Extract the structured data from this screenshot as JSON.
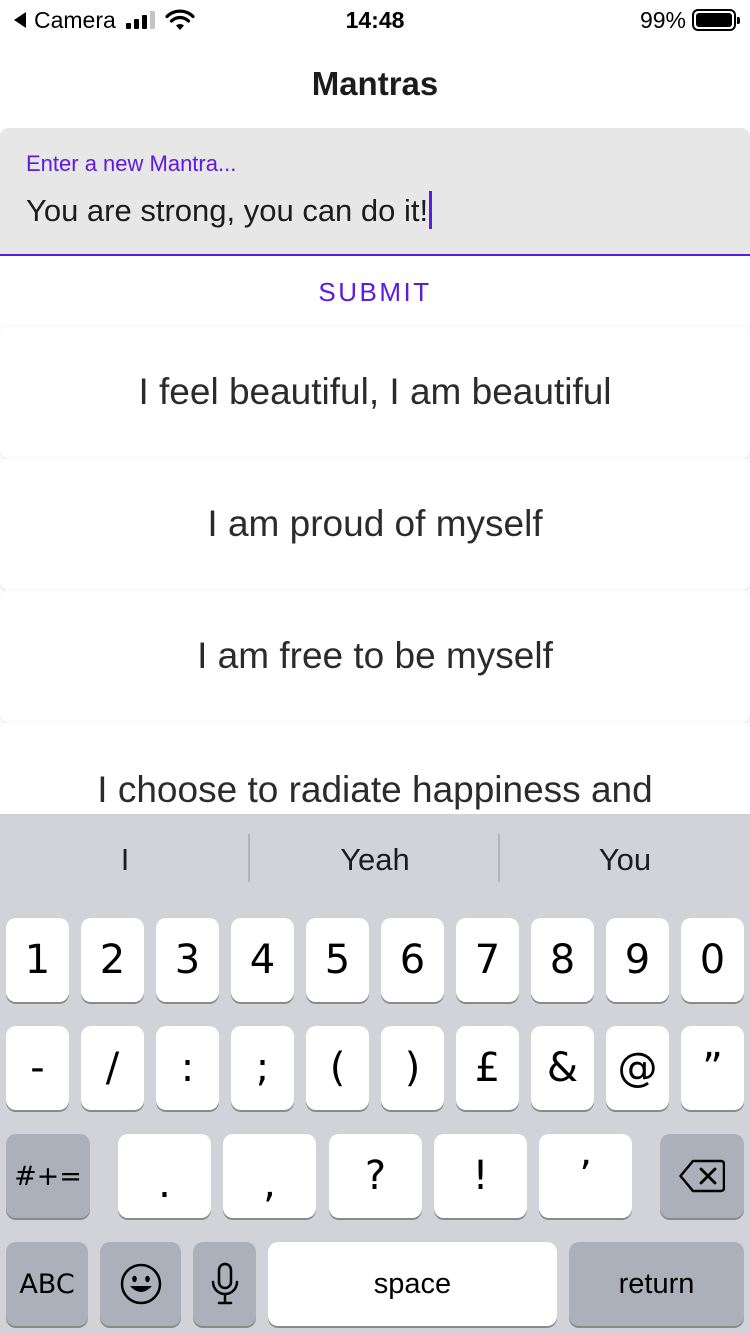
{
  "status_bar": {
    "back_app": "Camera",
    "time": "14:48",
    "battery_percent_label": "99%",
    "battery_level": 0.99
  },
  "nav": {
    "title": "Mantras"
  },
  "mantra_input": {
    "label": "Enter a new Mantra...",
    "value": "You are strong, you can do it!"
  },
  "submit_label": "SUBMIT",
  "mantras": [
    "I feel beautiful, I am beautiful",
    "I am proud of myself",
    "I am free to be myself",
    "I choose to radiate happiness and"
  ],
  "keyboard": {
    "suggestions": [
      "I",
      "Yeah",
      "You"
    ],
    "row1": [
      "1",
      "2",
      "3",
      "4",
      "5",
      "6",
      "7",
      "8",
      "9",
      "0"
    ],
    "row2": [
      "-",
      "/",
      ":",
      ";",
      "(",
      ")",
      "£",
      "&",
      "@",
      "”"
    ],
    "row3": [
      ".",
      ",",
      "?",
      "!",
      "’"
    ],
    "shift_label": "#+=",
    "abc_label": "ABC",
    "space_label": "space",
    "return_label": "return",
    "icons": [
      "backspace-icon",
      "emoji-icon",
      "microphone-icon"
    ]
  },
  "colors": {
    "accent": "#5d1be0",
    "field_background": "#e7e7e7",
    "keyboard_background": "#d1d3d9"
  }
}
